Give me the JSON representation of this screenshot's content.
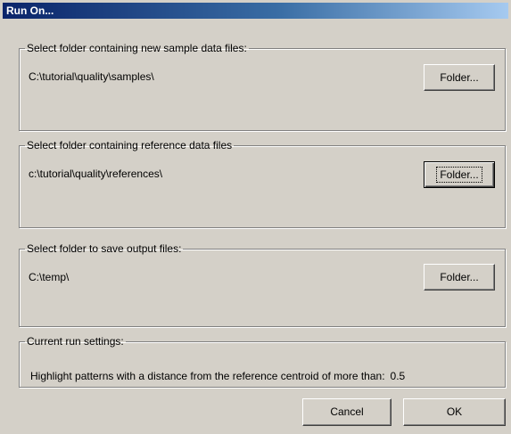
{
  "window": {
    "title": "Run On..."
  },
  "groups": {
    "samples": {
      "legend": "Select folder containing new sample data files:",
      "path": "C:\\tutorial\\quality\\samples\\",
      "button_label": "Folder..."
    },
    "references": {
      "legend": "Select folder containing reference data files",
      "path": "c:\\tutorial\\quality\\references\\",
      "button_label": "Folder..."
    },
    "output": {
      "legend": "Select folder to save output files:",
      "path": "C:\\temp\\",
      "button_label": "Folder..."
    },
    "settings": {
      "legend": "Current run settings:",
      "text": "Highlight patterns with a distance from the reference centroid of more than:",
      "value": "0.5"
    }
  },
  "buttons": {
    "cancel": "Cancel",
    "ok": "OK"
  }
}
